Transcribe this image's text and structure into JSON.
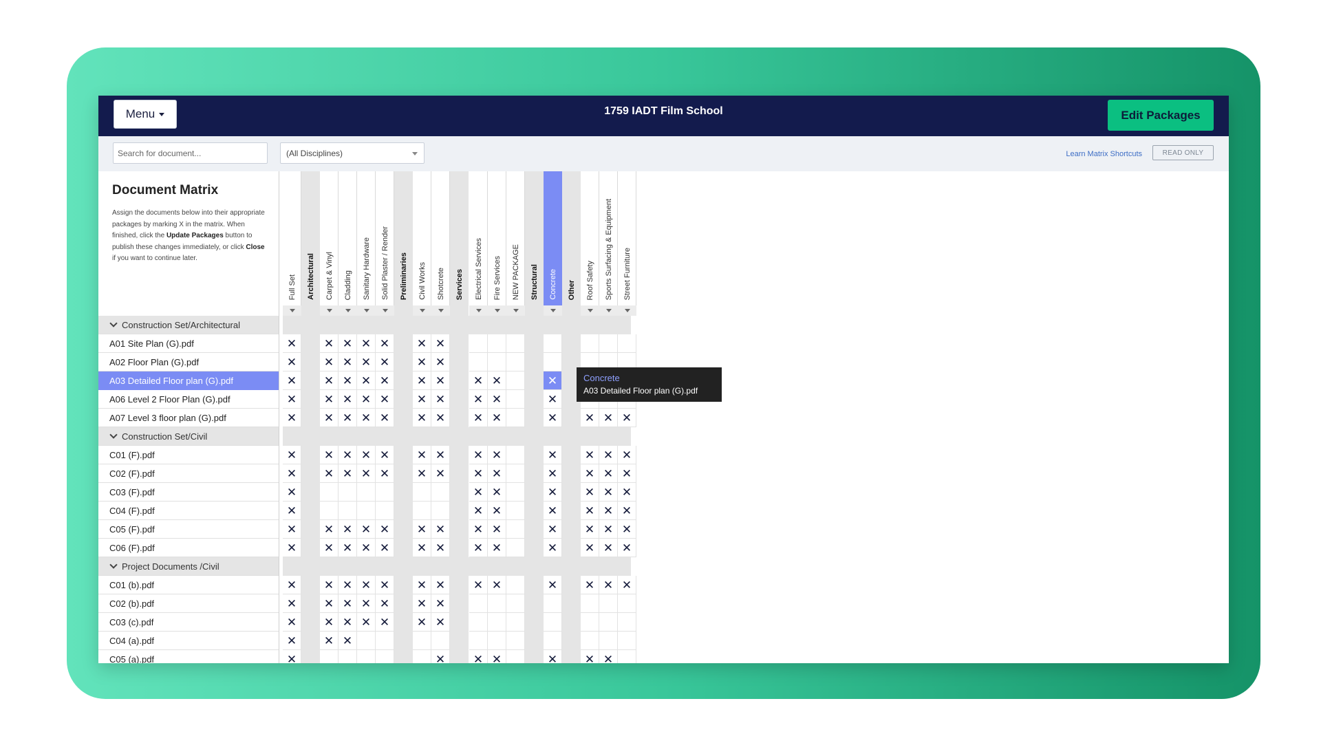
{
  "header": {
    "menu_label": "Menu",
    "project_title": "1759 IADT Film School",
    "edit_label": "Edit Packages"
  },
  "filters": {
    "search_placeholder": "Search for document...",
    "discipline_value": "(All Disciplines)",
    "shortcuts_link": "Learn Matrix Shortcuts",
    "read_only_badge": "READ ONLY"
  },
  "intro": {
    "heading": "Document Matrix",
    "text_1": "Assign the documents below into their appropriate packages by marking X in the matrix. When finished, click the ",
    "bold_1": "Update Packages",
    "text_2": " button to publish these changes immediately, or click ",
    "bold_2": "Close",
    "text_3": " if you want to continue later."
  },
  "columns": [
    {
      "label": "Full Set",
      "type": "package"
    },
    {
      "label": "Architectural",
      "type": "group"
    },
    {
      "label": "Carpet & Vinyl",
      "type": "package"
    },
    {
      "label": "Cladding",
      "type": "package"
    },
    {
      "label": "Sanitary Hardware",
      "type": "package"
    },
    {
      "label": "Solid Plaster / Render",
      "type": "package"
    },
    {
      "label": "Preliminaries",
      "type": "group"
    },
    {
      "label": "Civil Works",
      "type": "package"
    },
    {
      "label": "Shotcrete",
      "type": "package"
    },
    {
      "label": "Services",
      "type": "group"
    },
    {
      "label": "Electrical Services",
      "type": "package"
    },
    {
      "label": "Fire Services",
      "type": "package"
    },
    {
      "label": "NEW PACKAGE",
      "type": "package"
    },
    {
      "label": "Structural",
      "type": "group"
    },
    {
      "label": "Concrete",
      "type": "package",
      "selected": true
    },
    {
      "label": "Other",
      "type": "group"
    },
    {
      "label": "Roof Safety",
      "type": "package"
    },
    {
      "label": "Sports Surfacing & Equipment",
      "type": "package"
    },
    {
      "label": "Street Furniture",
      "type": "package"
    }
  ],
  "cell_mark": "✕",
  "sections": [
    {
      "title": "Construction Set/Architectural",
      "rows": [
        {
          "name": "A01 Site Plan (G).pdf",
          "marks": [
            "Full Set",
            "Carpet & Vinyl",
            "Cladding",
            "Sanitary Hardware",
            "Solid Plaster / Render",
            "Civil Works",
            "Shotcrete"
          ]
        },
        {
          "name": "A02 Floor Plan (G).pdf",
          "marks": [
            "Full Set",
            "Carpet & Vinyl",
            "Cladding",
            "Sanitary Hardware",
            "Solid Plaster / Render",
            "Civil Works",
            "Shotcrete"
          ]
        },
        {
          "name": "A03 Detailed Floor plan (G).pdf",
          "selected": true,
          "marks": [
            "Full Set",
            "Carpet & Vinyl",
            "Cladding",
            "Sanitary Hardware",
            "Solid Plaster / Render",
            "Civil Works",
            "Shotcrete",
            "Electrical Services",
            "Fire Services",
            "Concrete"
          ]
        },
        {
          "name": "A06 Level 2 Floor Plan (G).pdf",
          "marks": [
            "Full Set",
            "Carpet & Vinyl",
            "Cladding",
            "Sanitary Hardware",
            "Solid Plaster / Render",
            "Civil Works",
            "Shotcrete",
            "Electrical Services",
            "Fire Services",
            "Concrete"
          ]
        },
        {
          "name": "A07 Level 3 floor plan (G).pdf",
          "marks": [
            "Full Set",
            "Carpet & Vinyl",
            "Cladding",
            "Sanitary Hardware",
            "Solid Plaster / Render",
            "Civil Works",
            "Shotcrete",
            "Electrical Services",
            "Fire Services",
            "Concrete",
            "Roof Safety",
            "Sports Surfacing & Equipment",
            "Street Furniture"
          ]
        }
      ]
    },
    {
      "title": "Construction Set/Civil",
      "rows": [
        {
          "name": "C01 (F).pdf",
          "marks": [
            "Full Set",
            "Carpet & Vinyl",
            "Cladding",
            "Sanitary Hardware",
            "Solid Plaster / Render",
            "Civil Works",
            "Shotcrete",
            "Electrical Services",
            "Fire Services",
            "Concrete",
            "Roof Safety",
            "Sports Surfacing & Equipment",
            "Street Furniture"
          ]
        },
        {
          "name": "C02 (F).pdf",
          "marks": [
            "Full Set",
            "Carpet & Vinyl",
            "Cladding",
            "Sanitary Hardware",
            "Solid Plaster / Render",
            "Civil Works",
            "Shotcrete",
            "Electrical Services",
            "Fire Services",
            "Concrete",
            "Roof Safety",
            "Sports Surfacing & Equipment",
            "Street Furniture"
          ]
        },
        {
          "name": "C03 (F).pdf",
          "marks": [
            "Full Set",
            "Electrical Services",
            "Fire Services",
            "Concrete",
            "Roof Safety",
            "Sports Surfacing & Equipment",
            "Street Furniture"
          ]
        },
        {
          "name": "C04 (F).pdf",
          "marks": [
            "Full Set",
            "Electrical Services",
            "Fire Services",
            "Concrete",
            "Roof Safety",
            "Sports Surfacing & Equipment",
            "Street Furniture"
          ]
        },
        {
          "name": "C05 (F).pdf",
          "marks": [
            "Full Set",
            "Carpet & Vinyl",
            "Cladding",
            "Sanitary Hardware",
            "Solid Plaster / Render",
            "Civil Works",
            "Shotcrete",
            "Electrical Services",
            "Fire Services",
            "Concrete",
            "Roof Safety",
            "Sports Surfacing & Equipment",
            "Street Furniture"
          ]
        },
        {
          "name": "C06 (F).pdf",
          "marks": [
            "Full Set",
            "Carpet & Vinyl",
            "Cladding",
            "Sanitary Hardware",
            "Solid Plaster / Render",
            "Civil Works",
            "Shotcrete",
            "Electrical Services",
            "Fire Services",
            "Concrete",
            "Roof Safety",
            "Sports Surfacing & Equipment",
            "Street Furniture"
          ]
        }
      ]
    },
    {
      "title": "Project Documents /Civil",
      "rows": [
        {
          "name": "C01 (b).pdf",
          "marks": [
            "Full Set",
            "Carpet & Vinyl",
            "Cladding",
            "Sanitary Hardware",
            "Solid Plaster / Render",
            "Civil Works",
            "Shotcrete",
            "Electrical Services",
            "Fire Services",
            "Concrete",
            "Roof Safety",
            "Sports Surfacing & Equipment",
            "Street Furniture"
          ]
        },
        {
          "name": "C02 (b).pdf",
          "marks": [
            "Full Set",
            "Carpet & Vinyl",
            "Cladding",
            "Sanitary Hardware",
            "Solid Plaster / Render",
            "Civil Works",
            "Shotcrete"
          ]
        },
        {
          "name": "C03 (c).pdf",
          "marks": [
            "Full Set",
            "Carpet & Vinyl",
            "Cladding",
            "Sanitary Hardware",
            "Solid Plaster / Render",
            "Civil Works",
            "Shotcrete"
          ]
        },
        {
          "name": "C04 (a).pdf",
          "marks": [
            "Full Set",
            "Carpet & Vinyl",
            "Cladding"
          ]
        },
        {
          "name": "C05 (a).pdf",
          "marks": [
            "Full Set",
            "Shotcrete",
            "Electrical Services",
            "Fire Services",
            "Concrete",
            "Roof Safety",
            "Sports Surfacing & Equipment"
          ]
        }
      ]
    }
  ],
  "tooltip": {
    "package": "Concrete",
    "document": "A03 Detailed Floor plan (G).pdf"
  }
}
